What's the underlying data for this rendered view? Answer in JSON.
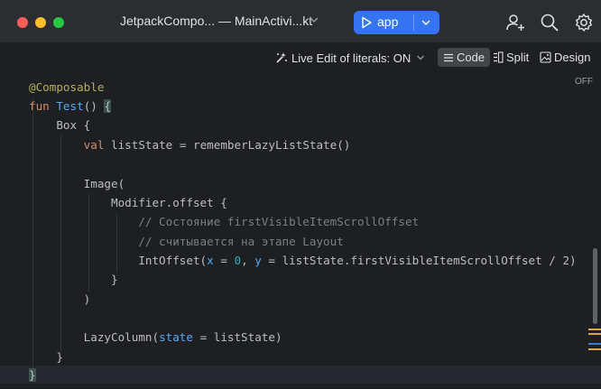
{
  "window": {
    "title": "JetpackCompo... — MainActivi...kt",
    "run_config": "app"
  },
  "toolbar": {
    "live_edit": "Live Edit of literals: ON",
    "code_label": "Code",
    "split_label": "Split",
    "design_label": "Design"
  },
  "editor": {
    "inspection_status": "OFF",
    "lines": [
      "@Composable",
      "fun Test() {",
      "    Box {",
      "        val listState = rememberLazyListState()",
      "",
      "        Image(",
      "            Modifier.offset {",
      "                // Состояние firstVisibleItemScrollOffset",
      "                // считывается на этапе Layout",
      "                IntOffset(x = 0, y = listState.firstVisibleItemScrollOffset / 2)",
      "            }",
      "        )",
      "",
      "        LazyColumn(state = listState)",
      "    }",
      "}"
    ]
  },
  "colors": {
    "accent": "#3574f0",
    "annotation": "#b3ae60",
    "keyword": "#cf8e6d",
    "function": "#56a8f5",
    "comment": "#7a7e85",
    "number": "#2aacb8"
  }
}
